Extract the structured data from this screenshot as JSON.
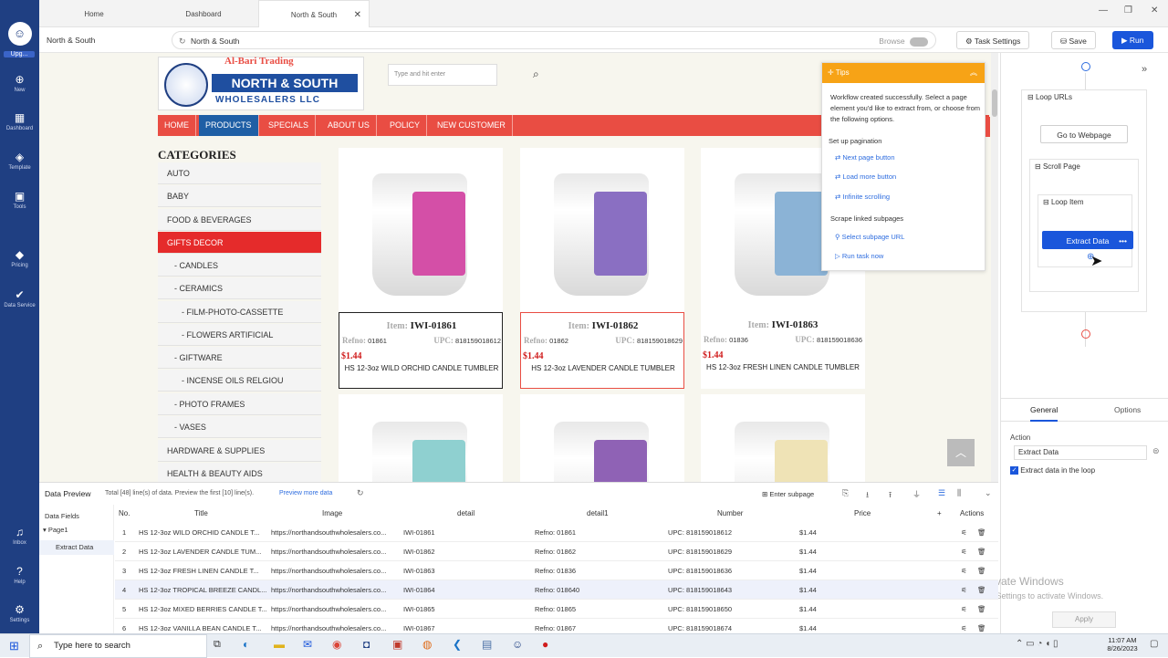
{
  "rail": {
    "items": [
      {
        "label": "Upg...",
        "icon": "avatar-icon"
      },
      {
        "label": "New",
        "icon": "plus-icon"
      },
      {
        "label": "Dashboard",
        "icon": "dashboard-icon"
      },
      {
        "label": "Template",
        "icon": "template-icon"
      },
      {
        "label": "Tools",
        "icon": "tools-icon"
      },
      {
        "label": "Pricing",
        "icon": "pricing-icon"
      },
      {
        "label": "Data Service",
        "icon": "data-service-icon"
      },
      {
        "label": "Inbox",
        "icon": "bell-icon"
      },
      {
        "label": "Help",
        "icon": "help-icon"
      },
      {
        "label": "Settings",
        "icon": "gear-icon"
      }
    ]
  },
  "tabs": [
    "Home",
    "Dashboard",
    "North & South"
  ],
  "toolbar": {
    "breadcrumb": "North & South",
    "url": "North & South",
    "browse": "Browse",
    "task_settings": "Task Settings",
    "save": "Save",
    "run": "Run"
  },
  "site": {
    "search_placeholder": "Type and hit enter",
    "logo_top": "Al-Bari Trading",
    "logo_main": "NORTH & SOUTH",
    "logo_sub": "WHOLESALERS LLC",
    "nav": [
      "HOME",
      "PRODUCTS",
      "SPECIALS",
      "ABOUT US",
      "POLICY",
      "NEW CUSTOMER"
    ],
    "categories_title": "CATEGORIES",
    "categories": [
      "AUTO",
      "BABY",
      "FOOD & BEVERAGES",
      "GIFTS DECOR",
      "- CANDLES",
      "- CERAMICS",
      "- FILM-PHOTO-CASSETTE",
      "- FLOWERS ARTIFICIAL",
      "- GIFTWARE",
      "- INCENSE OILS RELGIOU",
      "- PHOTO FRAMES",
      "- VASES",
      "HARDWARE & SUPPLIES",
      "HEALTH & BEAUTY AIDS"
    ],
    "products": [
      {
        "item": "IWI-01861",
        "refno": "01861",
        "upc": "818159018612",
        "price": "$1.44",
        "title": "HS 12-3oz WILD ORCHID CANDLE TUMBLER",
        "label_text": "WILD ORCHID",
        "color": "#d44fa7"
      },
      {
        "item": "IWI-01862",
        "refno": "01862",
        "upc": "818159018629",
        "price": "$1.44",
        "title": "HS 12-3oz LAVENDER CANDLE TUMBLER",
        "label_text": "FRESH CUT LAVENDER",
        "color": "#8a6fc2"
      },
      {
        "item": "IWI-01863",
        "refno": "01836",
        "upc": "818159018636",
        "price": "$1.44",
        "title": "HS 12-3oz FRESH LINEN CANDLE TUMBLER",
        "label_text": "FRESH LINEN",
        "color": "#8bb3d6"
      },
      {
        "label_text": "TROPICAL BREEZE",
        "color": "#8fd0d0"
      },
      {
        "label_text": "MIXED BERRIES",
        "color": "#8f62b5"
      },
      {
        "label_text": "VANILLA BEAN",
        "color": "#efe3b6"
      }
    ],
    "item_key": "Item:",
    "refno_key": "Refno:",
    "upc_key": "UPC:"
  },
  "tips": {
    "title": "Tips",
    "message": "Workflow created successfully. Select a page element you'd like to extract from, or choose from the following options.",
    "pagination_title": "Set up pagination",
    "pagination_links": [
      "Next page button",
      "Load more button",
      "Infinite scrolling"
    ],
    "subpages_title": "Scrape linked subpages",
    "subpage_links": [
      "Select subpage URL",
      "Run task now"
    ]
  },
  "workflow": {
    "loop_urls": "Loop URLs",
    "go_to_webpage": "Go to Webpage",
    "scroll_page": "Scroll Page",
    "loop_item": "Loop Item",
    "extract_data": "Extract Data",
    "tab_general": "General",
    "tab_options": "Options",
    "action_label": "Action",
    "action_value": "Extract Data",
    "extract_in_loop": "Extract data in the loop",
    "apply": "Apply",
    "activate_title": "Activate Windows",
    "activate_sub": "Go to Settings to activate Windows."
  },
  "preview": {
    "title": "Data Preview",
    "summary": "Total [48] line(s) of data. Preview the first [10] line(s).",
    "preview_more": "Preview more data",
    "enter_subpage": "Enter subpage",
    "fields_title": "Data Fields",
    "page1": "Page1",
    "extract": "Extract Data",
    "columns": [
      "No.",
      "Title",
      "Image",
      "detail",
      "detail1",
      "Number",
      "Price",
      "Actions"
    ],
    "rows": [
      [
        "1",
        "HS 12-3oz WILD ORCHID CANDLE T...",
        "https://northandsouthwholesalers.co...",
        "IWI-01861",
        "Refno: 01861",
        "UPC: 818159018612",
        "$1.44"
      ],
      [
        "2",
        "HS 12-3oz LAVENDER CANDLE TUM...",
        "https://northandsouthwholesalers.co...",
        "IWI-01862",
        "Refno: 01862",
        "UPC: 818159018629",
        "$1.44"
      ],
      [
        "3",
        "HS 12-3oz FRESH LINEN CANDLE T...",
        "https://northandsouthwholesalers.co...",
        "IWI-01863",
        "Refno: 01836",
        "UPC: 818159018636",
        "$1.44"
      ],
      [
        "4",
        "HS 12-3oz TROPICAL BREEZE CANDL...",
        "https://northandsouthwholesalers.co...",
        "IWI-01864",
        "Refno: 018640",
        "UPC: 818159018643",
        "$1.44"
      ],
      [
        "5",
        "HS 12-3oz MIXED BERRIES CANDLE T...",
        "https://northandsouthwholesalers.co...",
        "IWI-01865",
        "Refno: 01865",
        "UPC: 818159018650",
        "$1.44"
      ],
      [
        "6",
        "HS 12-3oz VANILLA BEAN CANDLE T...",
        "https://northandsouthwholesalers.co...",
        "IWI-01867",
        "Refno: 01867",
        "UPC: 818159018674",
        "$1.44"
      ]
    ]
  },
  "taskbar": {
    "search": "Type here to search",
    "time": "11:07 AM",
    "date": "8/26/2023"
  }
}
